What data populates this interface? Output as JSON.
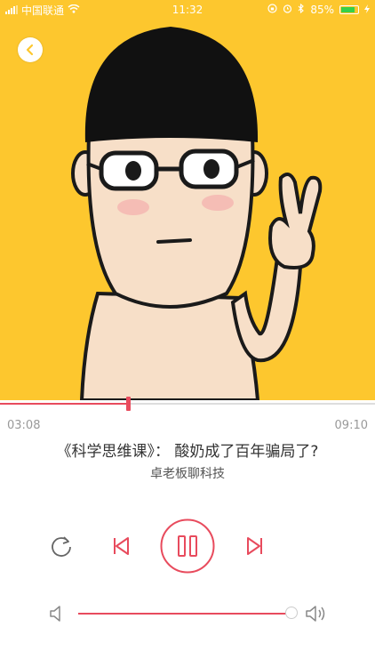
{
  "status_bar": {
    "carrier": "中国联通",
    "time": "11:32",
    "battery": "85%",
    "battery_level": 0.85
  },
  "player": {
    "current_time": "03:08",
    "total_time": "09:10",
    "progress": 0.342,
    "title": "《科学思维课》： 酸奶成了百年骗局了?",
    "author": "卓老板聊科技",
    "volume": 0.99,
    "accent_color": "#e84b5d",
    "cover_bg": "#FDC72E"
  }
}
